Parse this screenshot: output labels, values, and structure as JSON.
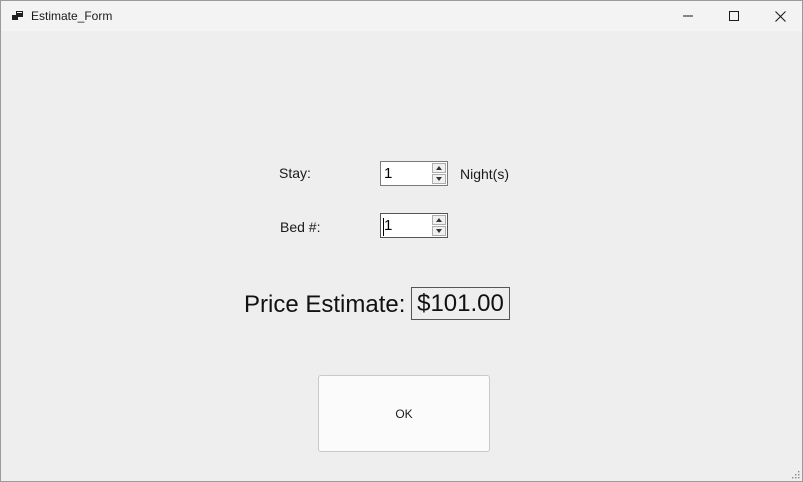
{
  "window": {
    "title": "Estimate_Form",
    "icon": "app-form-icon",
    "controls": {
      "minimize": "minimize-icon",
      "maximize": "maximize-icon",
      "close": "close-icon"
    }
  },
  "form": {
    "stay": {
      "label": "Stay:",
      "value": "1",
      "unit": "Night(s)"
    },
    "bed": {
      "label": "Bed #:",
      "value": "1"
    },
    "price": {
      "label": "Price Estimate:",
      "value": "$101.00"
    },
    "ok_label": "OK"
  },
  "colors": {
    "background": "#eeeeee",
    "titlebar": "#f3f3f3",
    "button_face": "#fbfbfb"
  }
}
